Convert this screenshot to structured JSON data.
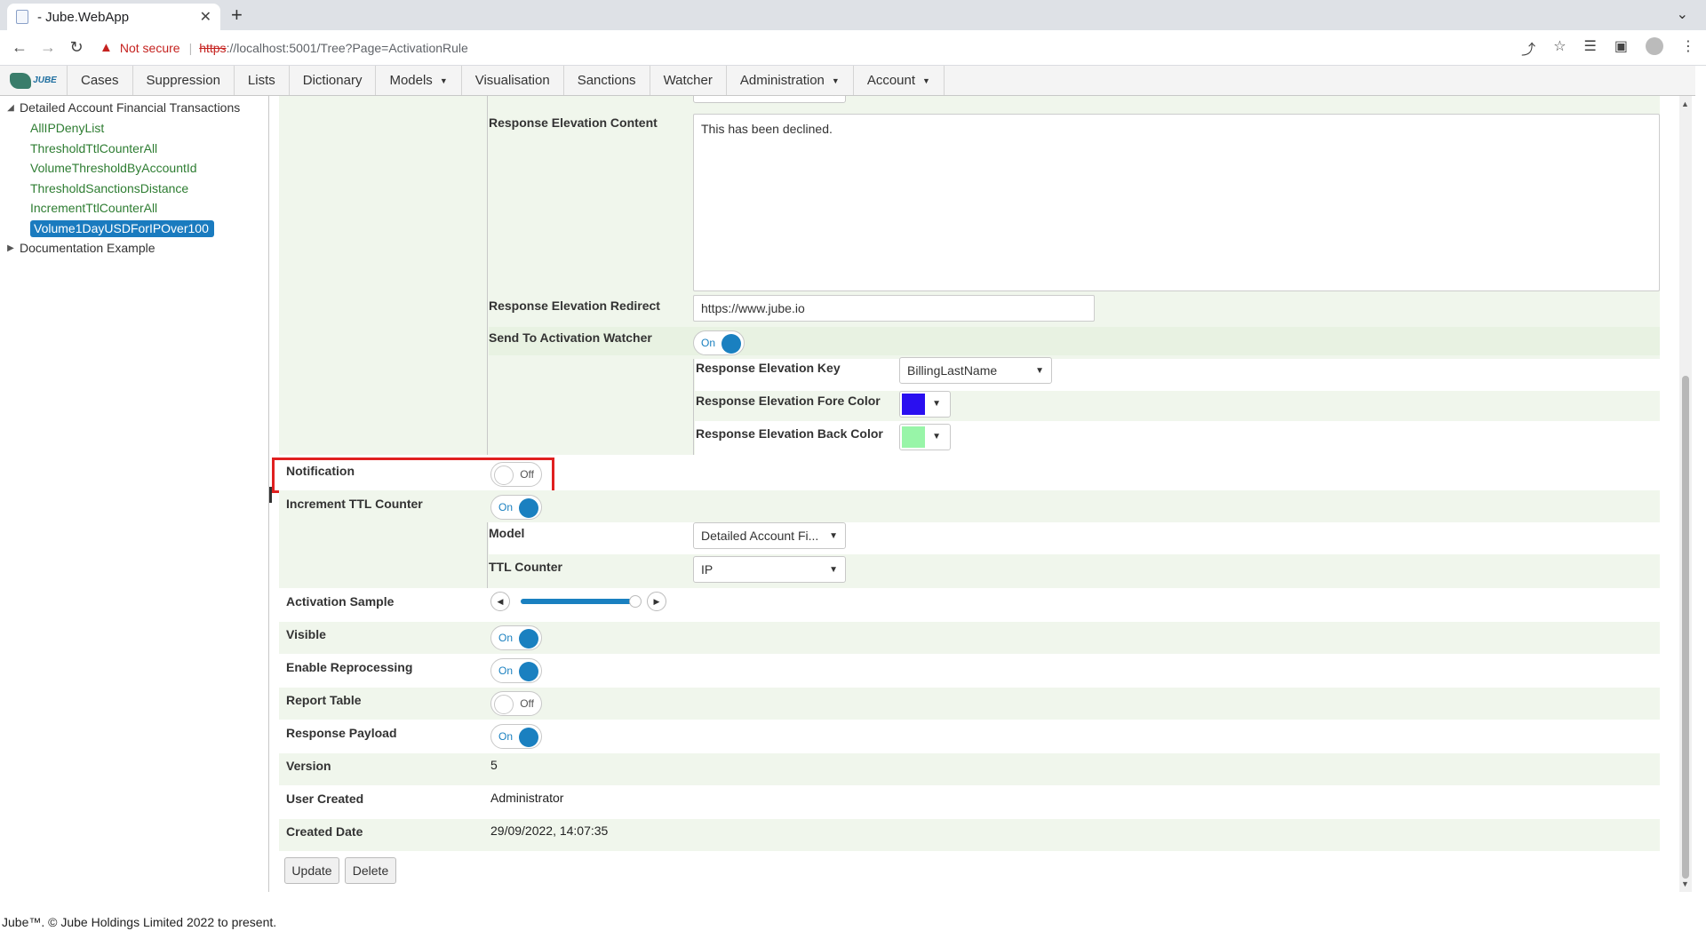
{
  "browser": {
    "tab_title": "- Jube.WebApp",
    "not_secure": "Not secure",
    "url_scheme": "https",
    "url_rest": "://localhost:5001/Tree?Page=ActivationRule"
  },
  "nav": {
    "items": [
      "Cases",
      "Suppression",
      "Lists",
      "Dictionary",
      "Models",
      "Visualisation",
      "Sanctions",
      "Watcher",
      "Administration",
      "Account"
    ],
    "logo_text": "JUBE"
  },
  "tree": {
    "parent": "Detailed Account Financial Transactions",
    "children": [
      "AllIPDenyList",
      "ThresholdTtlCounterAll",
      "VolumeThresholdByAccountId",
      "ThresholdSanctionsDistance",
      "IncrementTtlCounterAll",
      "Volume1DayUSDForIPOver100"
    ],
    "selected_index": 5,
    "collapsed": "Documentation Example"
  },
  "form": {
    "response_elevation_content_label": "Response Elevation Content",
    "response_elevation_content_value": "This has been declined.",
    "response_elevation_redirect_label": "Response Elevation Redirect",
    "response_elevation_redirect_value": "https://www.jube.io",
    "send_to_activation_watcher_label": "Send To Activation Watcher",
    "send_to_activation_watcher_state": "On",
    "response_elevation_key_label": "Response Elevation Key",
    "response_elevation_key_value": "BillingLastName",
    "fore_color_label": "Response Elevation Fore Color",
    "fore_color": "#2a0ff0",
    "back_color_label": "Response Elevation Back Color",
    "back_color": "#98f5a8",
    "notification_label": "Notification",
    "notification_state": "Off",
    "increment_ttl_label": "Increment TTL Counter",
    "increment_ttl_state": "On",
    "model_label": "Model",
    "model_value": "Detailed Account Fi...",
    "ttl_counter_label": "TTL Counter",
    "ttl_counter_value": "IP",
    "activation_sample_label": "Activation Sample",
    "activation_sample_fraction": 0.95,
    "visible_label": "Visible",
    "visible_state": "On",
    "enable_reprocessing_label": "Enable Reprocessing",
    "enable_reprocessing_state": "On",
    "report_table_label": "Report Table",
    "report_table_state": "Off",
    "response_payload_label": "Response Payload",
    "response_payload_state": "On",
    "version_label": "Version",
    "version_value": "5",
    "user_created_label": "User Created",
    "user_created_value": "Administrator",
    "created_date_label": "Created Date",
    "created_date_value": "29/09/2022, 14:07:35",
    "update_button": "Update",
    "delete_button": "Delete"
  },
  "footer": "Jube™. © Jube Holdings Limited 2022 to present.",
  "colors": {
    "accent": "#1a80c0",
    "highlight": "#e02020",
    "tree_leaf": "#2e7d32"
  }
}
